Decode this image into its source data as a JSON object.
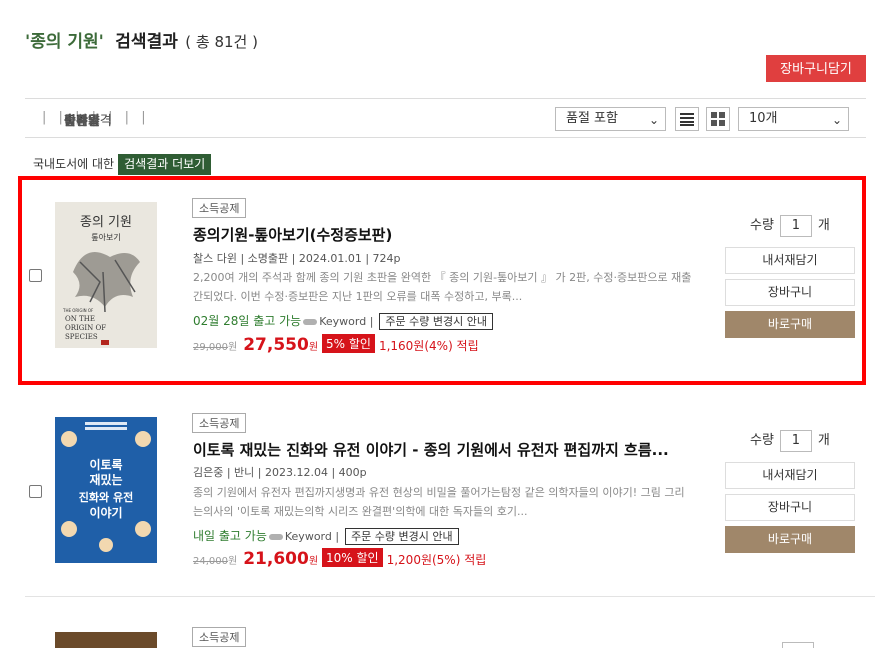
{
  "header": {
    "query": "'종의 기원'",
    "result_label": "검색결과",
    "count_text": "( 총 81건 )"
  },
  "cart_all_button": "장바구니담기",
  "sort": {
    "items": [
      "정확도",
      "판매량",
      "출간일",
      "상품명",
      "낮은가격",
      "높은가격",
      "할인율",
      "리뷰수"
    ],
    "active": "출간일",
    "filter_select": "품절 포함",
    "count_select": "10개"
  },
  "domestic": {
    "label": "국내도서에 대한",
    "more": "검색결과 더보기"
  },
  "items": [
    {
      "badge": "소득공제",
      "title": "종의기원-톺아보기(수정증보판)",
      "meta": "찰스 다윈 | 소명출판 | 2024.01.01 | 724p",
      "desc": "2,200여 개의 주석과 함께 종의 기원 초판을 완역한 『 종의 기원-톺아보기 』 가 2판, 수정·증보판으로 재출간되었다. 이번 수정·증보판은 지난 1판의 오류를 대폭 수정하고, 부록...",
      "ship_date": "02월 28일 출고 가능",
      "keyword": "Keyword |",
      "notice": "주문 수량 변경시 안내",
      "orig_price": "29,000",
      "orig_won": "원",
      "sale_price": "27,550",
      "sale_won": "원",
      "discount": "5% 할인",
      "points": "1,160원(4%) 적립",
      "qty_label": "수량",
      "qty_value": "1",
      "qty_unit": "개",
      "btn_wish": "내서재담기",
      "btn_cart": "장바구니",
      "btn_buy": "바로구매",
      "cover": {
        "title": "종의 기원",
        "subtitle": "톺아보기",
        "en1": "THE ORIGIN OF",
        "en2": "ON THE",
        "en3": "ORIGIN OF",
        "en4": "SPECIES"
      }
    },
    {
      "badge": "소득공제",
      "title": "이토록 재밌는 진화와 유전 이야기 - 종의 기원에서 유전자 편집까지 흐름...",
      "meta": "김은중 | 반니 | 2023.12.04 | 400p",
      "desc": "종의 기원에서 유전자 편집까지생명과 유전 현상의 비밀을 풀어가는탐정 같은 의학자들의 이야기! 그림 그리는의사의 '이토록 재밌는의학 시리즈 완결편'의학에 대한 독자들의 호기...",
      "ship_date": "내일 출고 가능",
      "keyword": "Keyword |",
      "notice": "주문 수량 변경시 안내",
      "orig_price": "24,000",
      "orig_won": "원",
      "sale_price": "21,600",
      "sale_won": "원",
      "discount": "10% 할인",
      "points": "1,200원(5%) 적립",
      "qty_label": "수량",
      "qty_value": "1",
      "qty_unit": "개",
      "btn_wish": "내서재담기",
      "btn_cart": "장바구니",
      "btn_buy": "바로구매",
      "cover": {
        "line1": "이토록",
        "line2": "재밌는",
        "line3": "진화와 유전",
        "line4": "이야기"
      }
    },
    {
      "badge": "소득공제"
    }
  ],
  "colors": {
    "accent_green": "#3d6b3a",
    "sale_red": "#d6131a",
    "buy_brown": "#a0876a",
    "highlight": "#ff0000"
  }
}
